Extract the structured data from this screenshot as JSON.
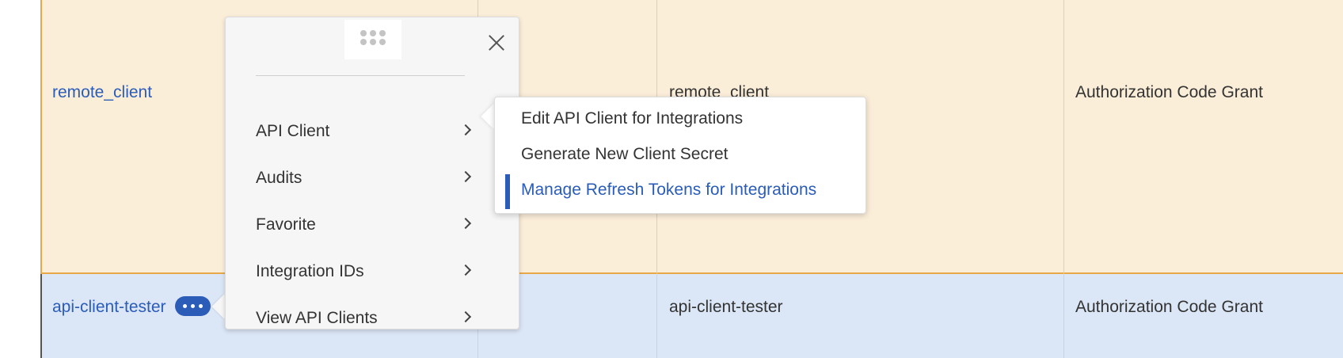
{
  "table": {
    "rows": [
      {
        "name": "",
        "col2": "",
        "col3": "",
        "col4": ""
      },
      {
        "name": "remote_client",
        "col2": "",
        "col3": "remote_client",
        "col4": "Authorization Code Grant"
      },
      {
        "name": "api-client-tester",
        "col2": "",
        "col3": "api-client-tester",
        "col4": "Authorization Code Grant"
      }
    ]
  },
  "actions_button": {
    "icon": "more-horizontal-icon"
  },
  "menu": {
    "close_icon": "close-icon",
    "drag_icon": "drag-handle-icon",
    "items": [
      {
        "label": "API Client"
      },
      {
        "label": "Audits"
      },
      {
        "label": "Favorite"
      },
      {
        "label": "Integration IDs"
      },
      {
        "label": "View API Clients"
      }
    ]
  },
  "submenu": {
    "items": [
      {
        "label": "Edit API Client for Integrations"
      },
      {
        "label": "Generate New Client Secret"
      },
      {
        "label": "Manage Refresh Tokens for Integrations",
        "active": true
      }
    ]
  },
  "colors": {
    "accent": "#2a5cb8",
    "row_highlight": "#fbeed9",
    "row_selected": "#dbe6f6",
    "row_border": "#e8a84a"
  }
}
